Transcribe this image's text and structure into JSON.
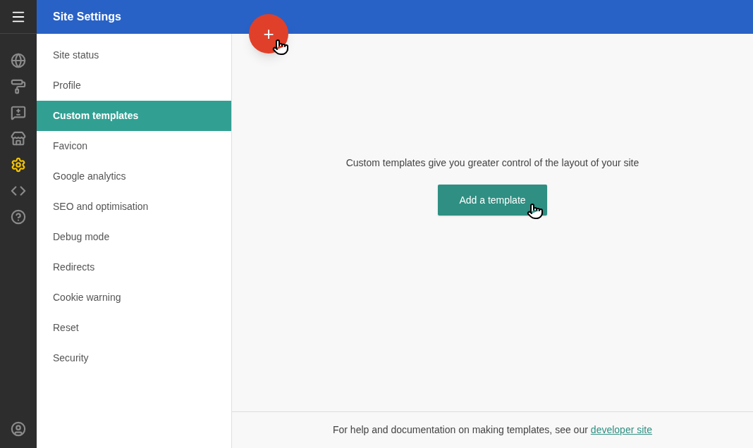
{
  "rail": {
    "items": [
      {
        "kind": "globe",
        "selected": false
      },
      {
        "kind": "roller",
        "selected": false
      },
      {
        "kind": "feedback",
        "selected": false
      },
      {
        "kind": "store",
        "selected": false
      },
      {
        "kind": "settings",
        "selected": true
      },
      {
        "kind": "code",
        "selected": false
      },
      {
        "kind": "help",
        "selected": false
      }
    ]
  },
  "header": {
    "title": "Site Settings",
    "fab": "+"
  },
  "sidebar": {
    "items": [
      {
        "label": "Site status",
        "selected": false
      },
      {
        "label": "Profile",
        "selected": false
      },
      {
        "label": "Custom templates",
        "selected": true
      },
      {
        "label": "Favicon",
        "selected": false
      },
      {
        "label": "Google analytics",
        "selected": false
      },
      {
        "label": "SEO and optimisation",
        "selected": false
      },
      {
        "label": "Debug mode",
        "selected": false
      },
      {
        "label": "Redirects",
        "selected": false
      },
      {
        "label": "Cookie warning",
        "selected": false
      },
      {
        "label": "Reset",
        "selected": false
      },
      {
        "label": "Security",
        "selected": false
      }
    ]
  },
  "main": {
    "message": "Custom templates give you greater control of the layout of your site",
    "button": "Add a template"
  },
  "footer": {
    "text": "For help and documentation on making templates, see our",
    "link": "developer site"
  }
}
